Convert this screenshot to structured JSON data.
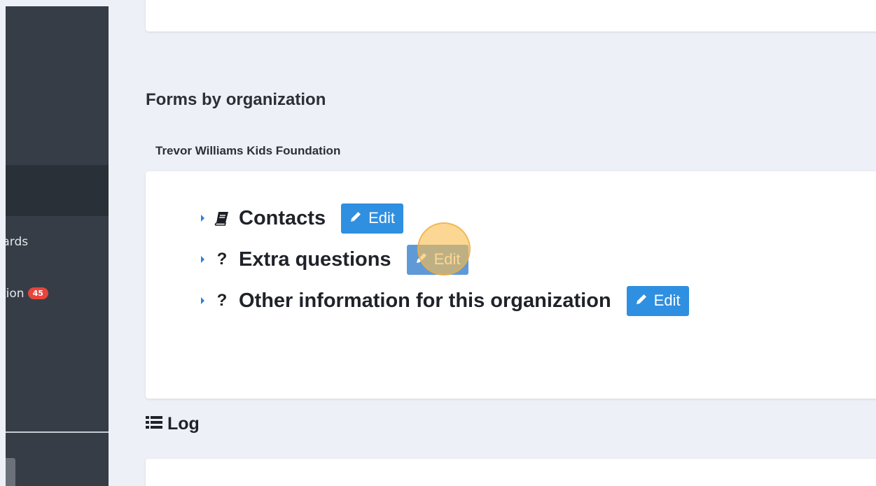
{
  "sidebar": {
    "items": [
      {
        "label": "cards",
        "partial": true
      },
      {
        "label": "tion",
        "badge": "45",
        "partial": true
      }
    ]
  },
  "main": {
    "section_title": "Forms by organization",
    "organization_name": "Trevor Williams Kids Foundation",
    "forms": [
      {
        "icon": "book-icon",
        "label": "Contacts",
        "edit_label": "Edit"
      },
      {
        "icon": "question-icon",
        "icon_text": "?",
        "label": "Extra questions",
        "edit_label": "Edit"
      },
      {
        "icon": "question-icon",
        "icon_text": "?",
        "label": "Other information for this organization",
        "edit_label": "Edit"
      }
    ],
    "log_title": "Log"
  },
  "colors": {
    "sidebar_bg": "#363d47",
    "accent": "#2f8fe0",
    "badge": "#e8453c",
    "click_marker": "#f8be50"
  }
}
